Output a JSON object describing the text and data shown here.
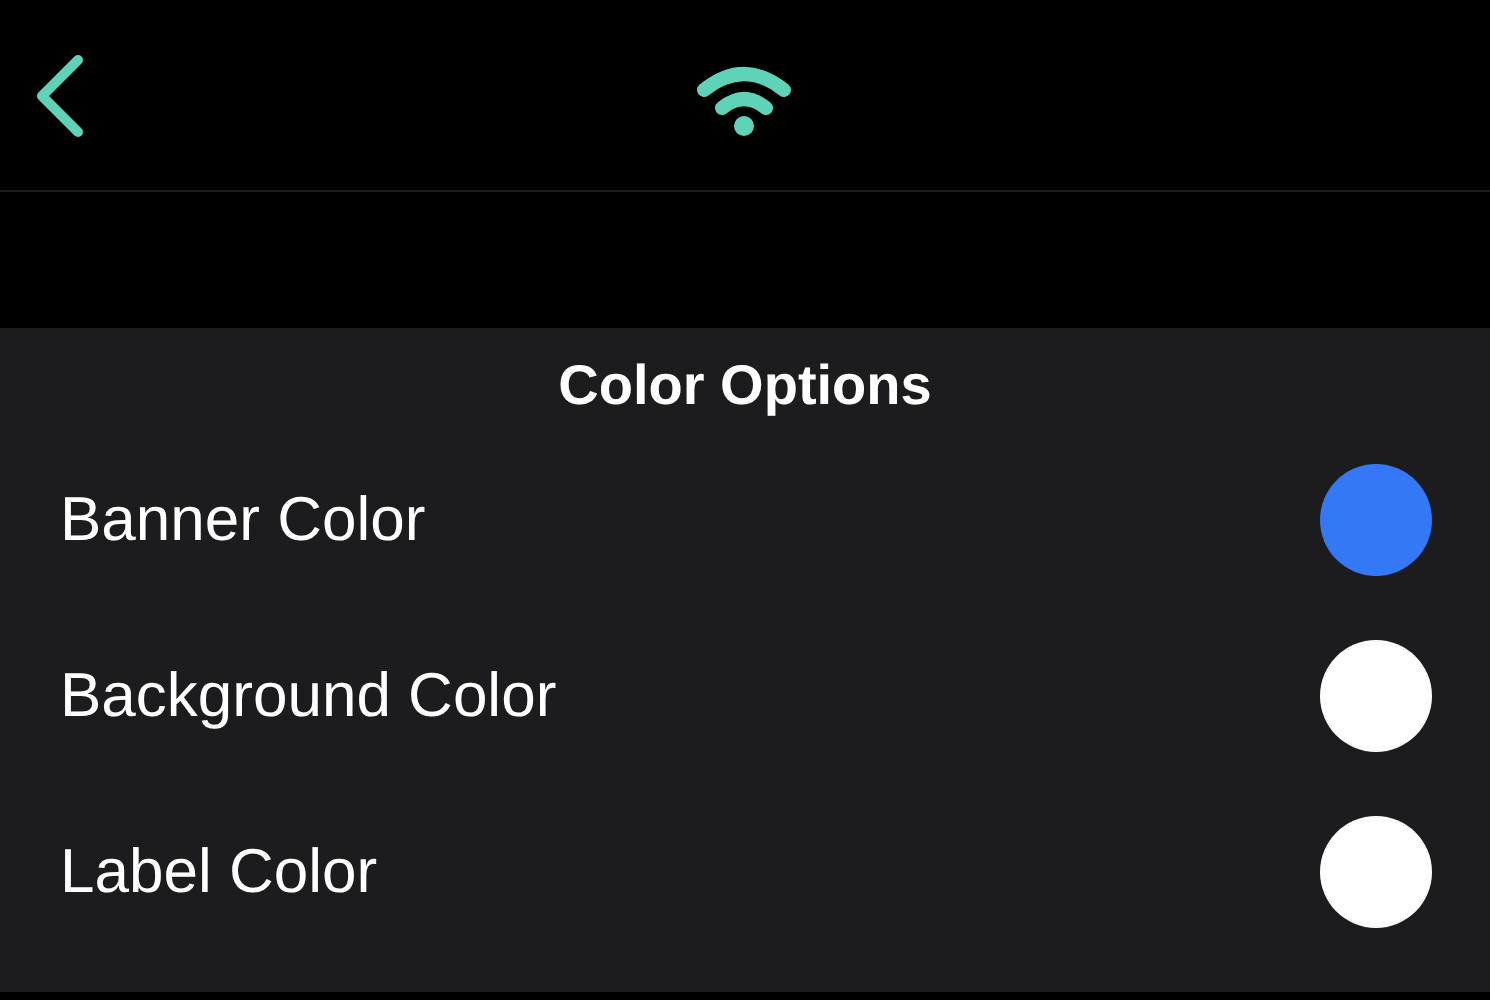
{
  "section": {
    "title": "Color Options"
  },
  "rows": [
    {
      "label": "Banner Color",
      "color": "#3478f6"
    },
    {
      "label": "Background Color",
      "color": "#ffffff"
    },
    {
      "label": "Label Color",
      "color": "#ffffff"
    }
  ]
}
